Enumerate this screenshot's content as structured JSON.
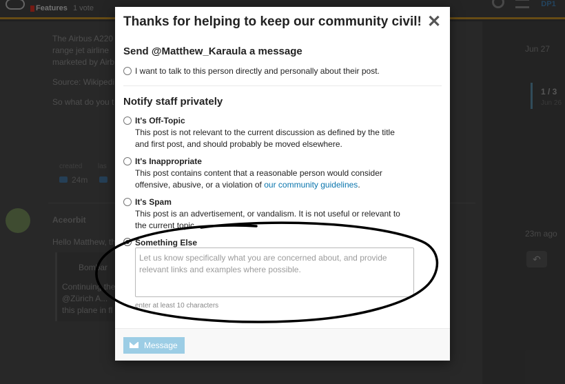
{
  "background": {
    "header": {
      "category": "Features",
      "subcategory": "1 vote",
      "user_badge": "DP1"
    },
    "post": {
      "lines": [
        "The Airbus A220",
        "range jet airline",
        "marketed by Airb",
        "Source: Wikipedi",
        "So what do you t"
      ],
      "date": "Jun 27",
      "stats": {
        "created_label": "created",
        "last_label": "las",
        "created_value": "24m"
      }
    },
    "progress": {
      "position": "1 / 3",
      "date": "Jun 26"
    },
    "reply": {
      "author": "Aceorbit",
      "date": "23m ago",
      "greeting": "Hello Matthew, th",
      "quote_author": "Bombar",
      "quote_lines": [
        "Continuing the",
        "@Zürich A...",
        "this plane in fl"
      ],
      "reply_icon": "reply-icon"
    }
  },
  "modal": {
    "title": "Thanks for helping to keep our community civil!",
    "close_label": "✕",
    "send_heading": "Send @Matthew_Karaula a message",
    "send_option": "I want to talk to this person directly and personally about their post.",
    "notify_heading": "Notify staff privately",
    "options": [
      {
        "title": "It's Off-Topic",
        "lines": [
          "This post is not relevant to the current discussion as defined by the title",
          "and first post, and should probably be moved elsewhere."
        ],
        "checked": false
      },
      {
        "title": "It's Inappropriate",
        "line1": "This post contains content that a reasonable person would consider",
        "line2_prefix": "offensive, abusive, or a violation of ",
        "line2_link": "our community guidelines",
        "line2_suffix": ".",
        "checked": false
      },
      {
        "title": "It's Spam",
        "lines": [
          "This post is an advertisement, or vandalism. It is not useful or relevant to",
          "the current topic."
        ],
        "checked": false
      },
      {
        "title": "Something Else",
        "checked": true
      }
    ],
    "textarea_placeholder": "Let us know specifically what you are concerned about, and provide relevant links and examples where possible.",
    "hint": "enter at least 10 characters",
    "message_button": "Message",
    "colors": {
      "button": "#9ccde5",
      "link": "#0a75ad"
    }
  }
}
